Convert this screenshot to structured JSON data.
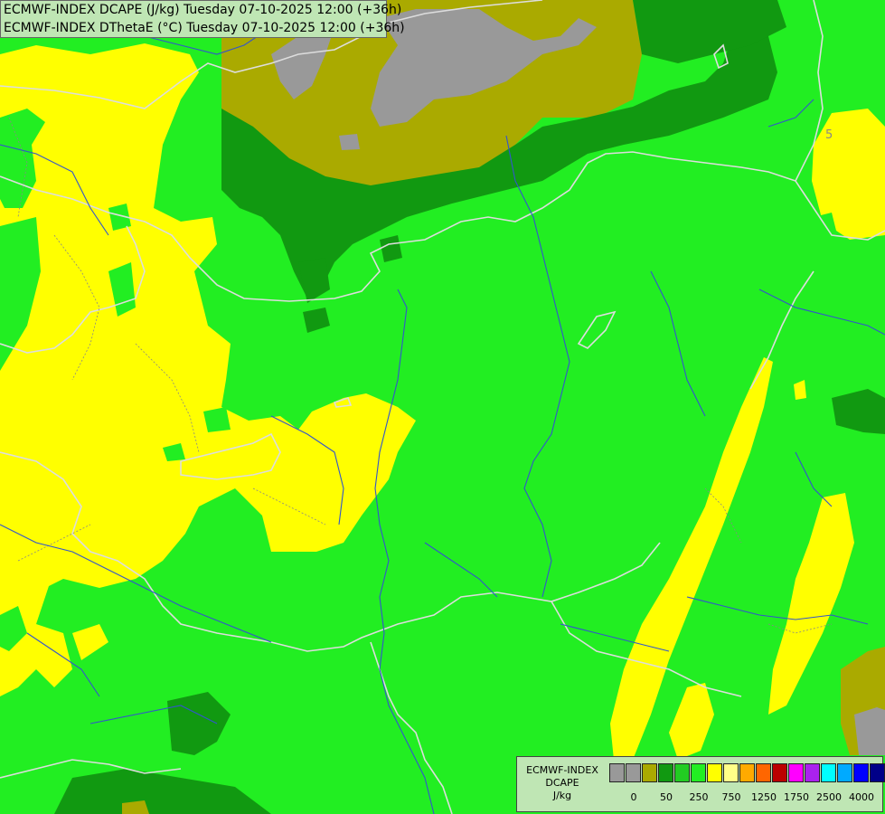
{
  "title": {
    "line1": "ECMWF-INDEX DCAPE (J/kg) Tuesday 07-10-2025 12:00 (+36h)",
    "line2": "ECMWF-INDEX DThetaE (°C) Tuesday 07-10-2025 12:00 (+36h)"
  },
  "map": {
    "contour_label": "5",
    "colors": {
      "background": "#22ee22",
      "light_yellow": "#ffff00",
      "olive": "#aaaa00",
      "dark_green": "#119911",
      "gray": "#999999",
      "border": "#dddddd",
      "river": "#3355cc"
    }
  },
  "legend": {
    "label_line1": "ECMWF-INDEX",
    "label_line2": "DCAPE",
    "label_line3": "J/kg",
    "colors": [
      "#999999",
      "#999999",
      "#aaaa00",
      "#119911",
      "#22cc22",
      "#22ee22",
      "#ffff00",
      "#ffff88",
      "#ffaa00",
      "#ff6600",
      "#bb0000",
      "#ff00ff",
      "#aa22ee",
      "#00ffff",
      "#00aaff",
      "#0000ff",
      "#000088"
    ],
    "ticks": [
      "0",
      "50",
      "250",
      "750",
      "1250",
      "1750",
      "2500",
      "4000"
    ]
  }
}
